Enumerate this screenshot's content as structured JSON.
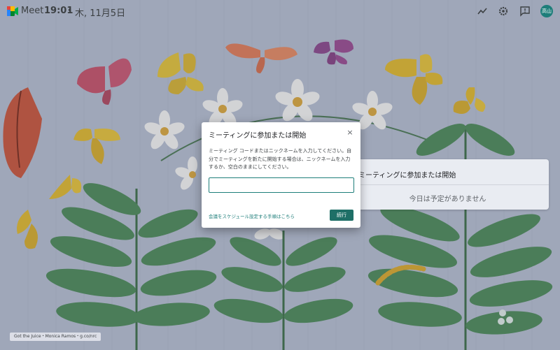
{
  "topbar": {
    "app_name": "Meet",
    "time": "19:01",
    "separator": "•",
    "date": "木, 11月5日",
    "icons": [
      "trending-icon",
      "gear-icon",
      "feedback-icon"
    ],
    "avatar_initials": "高山"
  },
  "background_card": {
    "title": "ミーティングに参加または開始",
    "empty_message": "今日は予定がありません"
  },
  "dialog": {
    "title": "ミーティングに参加または開始",
    "close_label": "×",
    "description": "ミーティング コードまたはニックネームを入力してください。自分でミーティングを新たに開始する場合は、ニックネームを入力するか、空白のままにしてください。",
    "input_value": "",
    "input_placeholder": "",
    "help_link": "会議をスケジュール設定する手順はこちら",
    "continue_label": "続行"
  },
  "credit": "Got the Juice・Monica Ramos・g.co/nrc",
  "colors": {
    "accent": "#1e7e7a",
    "button": "#1e6f67",
    "background": "#aeb7c9"
  }
}
